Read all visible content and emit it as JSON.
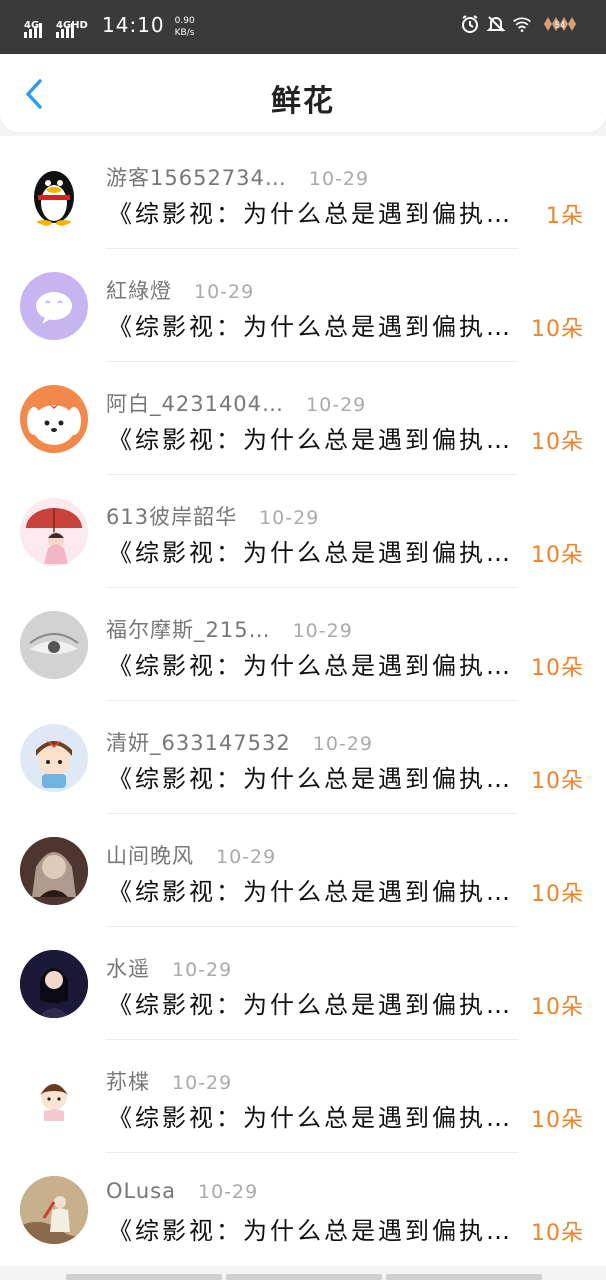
{
  "status_bar": {
    "sim1_label": "4G",
    "sim2_label": "4GHD",
    "time": "14:10",
    "speed_value": "0.90",
    "speed_unit": "KB/s",
    "battery_level": "54"
  },
  "header": {
    "title": "鲜花",
    "accent_color": "#2e9bf0"
  },
  "items": [
    {
      "user": "游客15652734…",
      "date": "10-29",
      "title": "《综影视：为什么总是遇到偏执…",
      "count": "1朵",
      "avatar": "qq-penguin-avatar"
    },
    {
      "user": "紅綠燈",
      "date": "10-29",
      "title": "《综影视：为什么总是遇到偏执…",
      "count": "10朵",
      "avatar": "purple-chat-avatar"
    },
    {
      "user": "阿白_4231404…",
      "date": "10-29",
      "title": "《综影视：为什么总是遇到偏执…",
      "count": "10朵",
      "avatar": "cartoon-dog-avatar"
    },
    {
      "user": "613彼岸韶华",
      "date": "10-29",
      "title": "《综影视：为什么总是遇到偏执…",
      "count": "10朵",
      "avatar": "umbrella-girl-avatar"
    },
    {
      "user": "福尔摩斯_215…",
      "date": "10-29",
      "title": "《综影视：为什么总是遇到偏执…",
      "count": "10朵",
      "avatar": "eye-closeup-avatar"
    },
    {
      "user": "清妍_633147532",
      "date": "10-29",
      "title": "《综影视：为什么总是遇到偏执…",
      "count": "10朵",
      "avatar": "cartoon-girl-avatar"
    },
    {
      "user": "山间晚风",
      "date": "10-29",
      "title": "《综影视：为什么总是遇到偏执…",
      "count": "10朵",
      "avatar": "anime-art-avatar"
    },
    {
      "user": "水遥",
      "date": "10-29",
      "title": "《综影视：为什么总是遇到偏执…",
      "count": "10朵",
      "avatar": "portrait-photo-avatar"
    },
    {
      "user": "荪楪",
      "date": "10-29",
      "title": "《综影视：为什么总是遇到偏执…",
      "count": "10朵",
      "avatar": "chibi-girl-avatar"
    },
    {
      "user": "OLusa",
      "date": "10-29",
      "title": "《综影视：为什么总是遇到偏执…",
      "count": "10朵",
      "avatar": "painting-avatar"
    }
  ],
  "colors": {
    "count_orange": "#f08228",
    "name_gray": "#777777",
    "date_gray": "#aaaaaa"
  }
}
